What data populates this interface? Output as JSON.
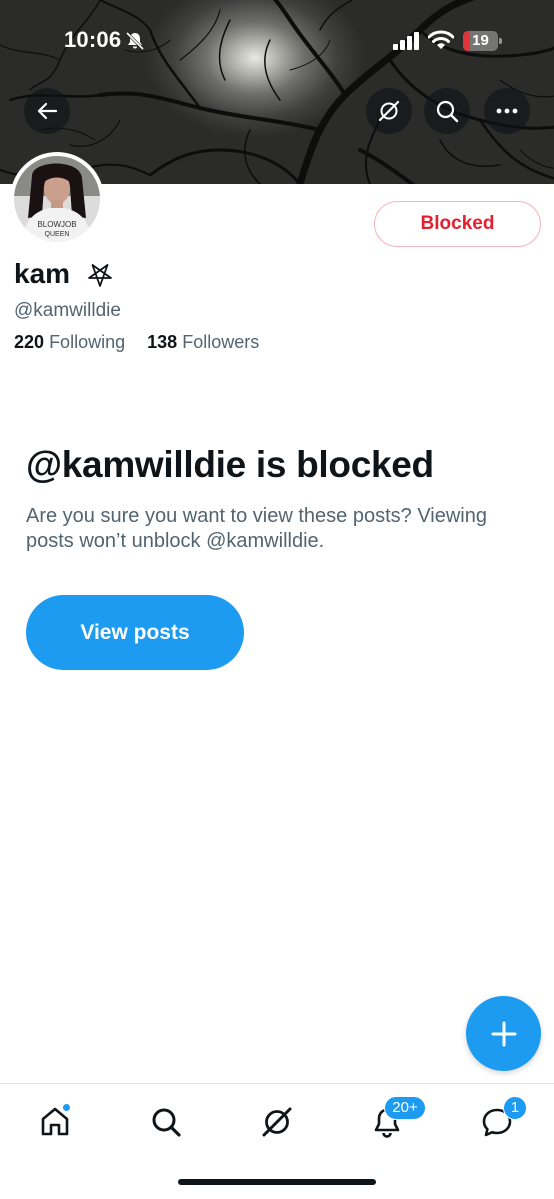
{
  "status_bar": {
    "time": "10:06",
    "battery_level": "19",
    "icons": [
      "bell-slash-icon",
      "cellular-signal-icon",
      "wifi-icon",
      "battery-icon"
    ]
  },
  "header": {
    "icons": [
      "back-arrow-icon",
      "grok-icon",
      "search-icon",
      "more-icon"
    ]
  },
  "profile": {
    "display_name": "kam",
    "handle": "@kamwilldie",
    "following_count": "220",
    "following_label": "Following",
    "followers_count": "138",
    "followers_label": "Followers",
    "blocked_button_label": "Blocked",
    "name_badge_icon": "pentagram-icon",
    "avatar_shirt_text": [
      "BLOWJOB",
      "QUEEN"
    ]
  },
  "blocked_notice": {
    "title": "@kamwilldie is blocked",
    "description": "Are you sure you want to view these posts? Viewing posts won’t unblock @kamwilldie.",
    "button_label": "View posts"
  },
  "fab": {
    "icon": "plus-icon"
  },
  "tab_bar": {
    "items": [
      {
        "name": "home",
        "icon": "home-icon",
        "has_dot": true
      },
      {
        "name": "search",
        "icon": "search-icon"
      },
      {
        "name": "grok",
        "icon": "grok-icon"
      },
      {
        "name": "notifications",
        "icon": "bell-icon",
        "badge": "20+"
      },
      {
        "name": "messages",
        "icon": "chat-bubble-icon",
        "badge": "1"
      }
    ]
  },
  "colors": {
    "accent": "#1d9bf0",
    "blocked_red": "#e4202f",
    "text_primary": "#0f1419",
    "text_secondary": "#536471"
  }
}
